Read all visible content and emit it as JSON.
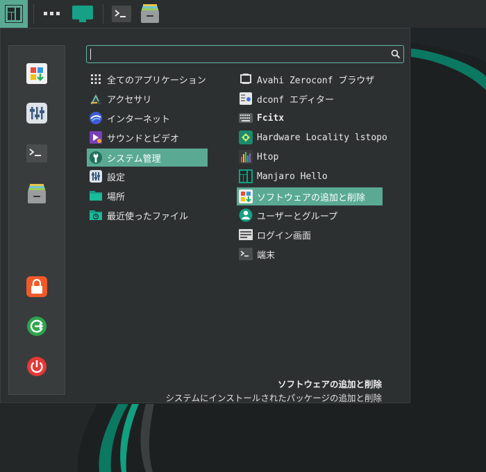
{
  "search": {
    "value": "",
    "placeholder": ""
  },
  "categories": [
    {
      "label": "全てのアプリケーション",
      "icon": "grid-dots-icon"
    },
    {
      "label": "アクセサリ",
      "icon": "accessories-icon"
    },
    {
      "label": "インターネット",
      "icon": "internet-icon"
    },
    {
      "label": "サウンドとビデオ",
      "icon": "multimedia-icon"
    },
    {
      "label": "システム管理",
      "icon": "system-admin-icon",
      "selected": true
    },
    {
      "label": "設定",
      "icon": "settings-icon"
    },
    {
      "label": "場所",
      "icon": "folder-icon"
    },
    {
      "label": "最近使ったファイル",
      "icon": "recent-files-icon"
    }
  ],
  "apps": [
    {
      "label": "Avahi Zeroconf ブラウザ",
      "icon": "network-icon"
    },
    {
      "label": "dconf エディター",
      "icon": "dconf-icon"
    },
    {
      "label": "Fcitx",
      "icon": "keyboard-icon"
    },
    {
      "label": "Hardware Locality lstopo",
      "icon": "hwloc-icon"
    },
    {
      "label": "Htop",
      "icon": "htop-icon"
    },
    {
      "label": "Manjaro Hello",
      "icon": "manjaro-icon"
    },
    {
      "label": "ソフトウェアの追加と削除",
      "icon": "software-icon",
      "selected": true
    },
    {
      "label": "ユーザーとグループ",
      "icon": "users-icon"
    },
    {
      "label": "ログイン画面",
      "icon": "login-screen-icon"
    },
    {
      "label": "端末",
      "icon": "terminal-icon"
    }
  ],
  "description": {
    "title": "ソフトウェアの追加と削除",
    "text": "システムにインストールされたパッケージの追加と削除"
  },
  "colors": {
    "accent": "#5aaa93",
    "panel": "#2b2e2f",
    "menu": "#2d3031"
  }
}
